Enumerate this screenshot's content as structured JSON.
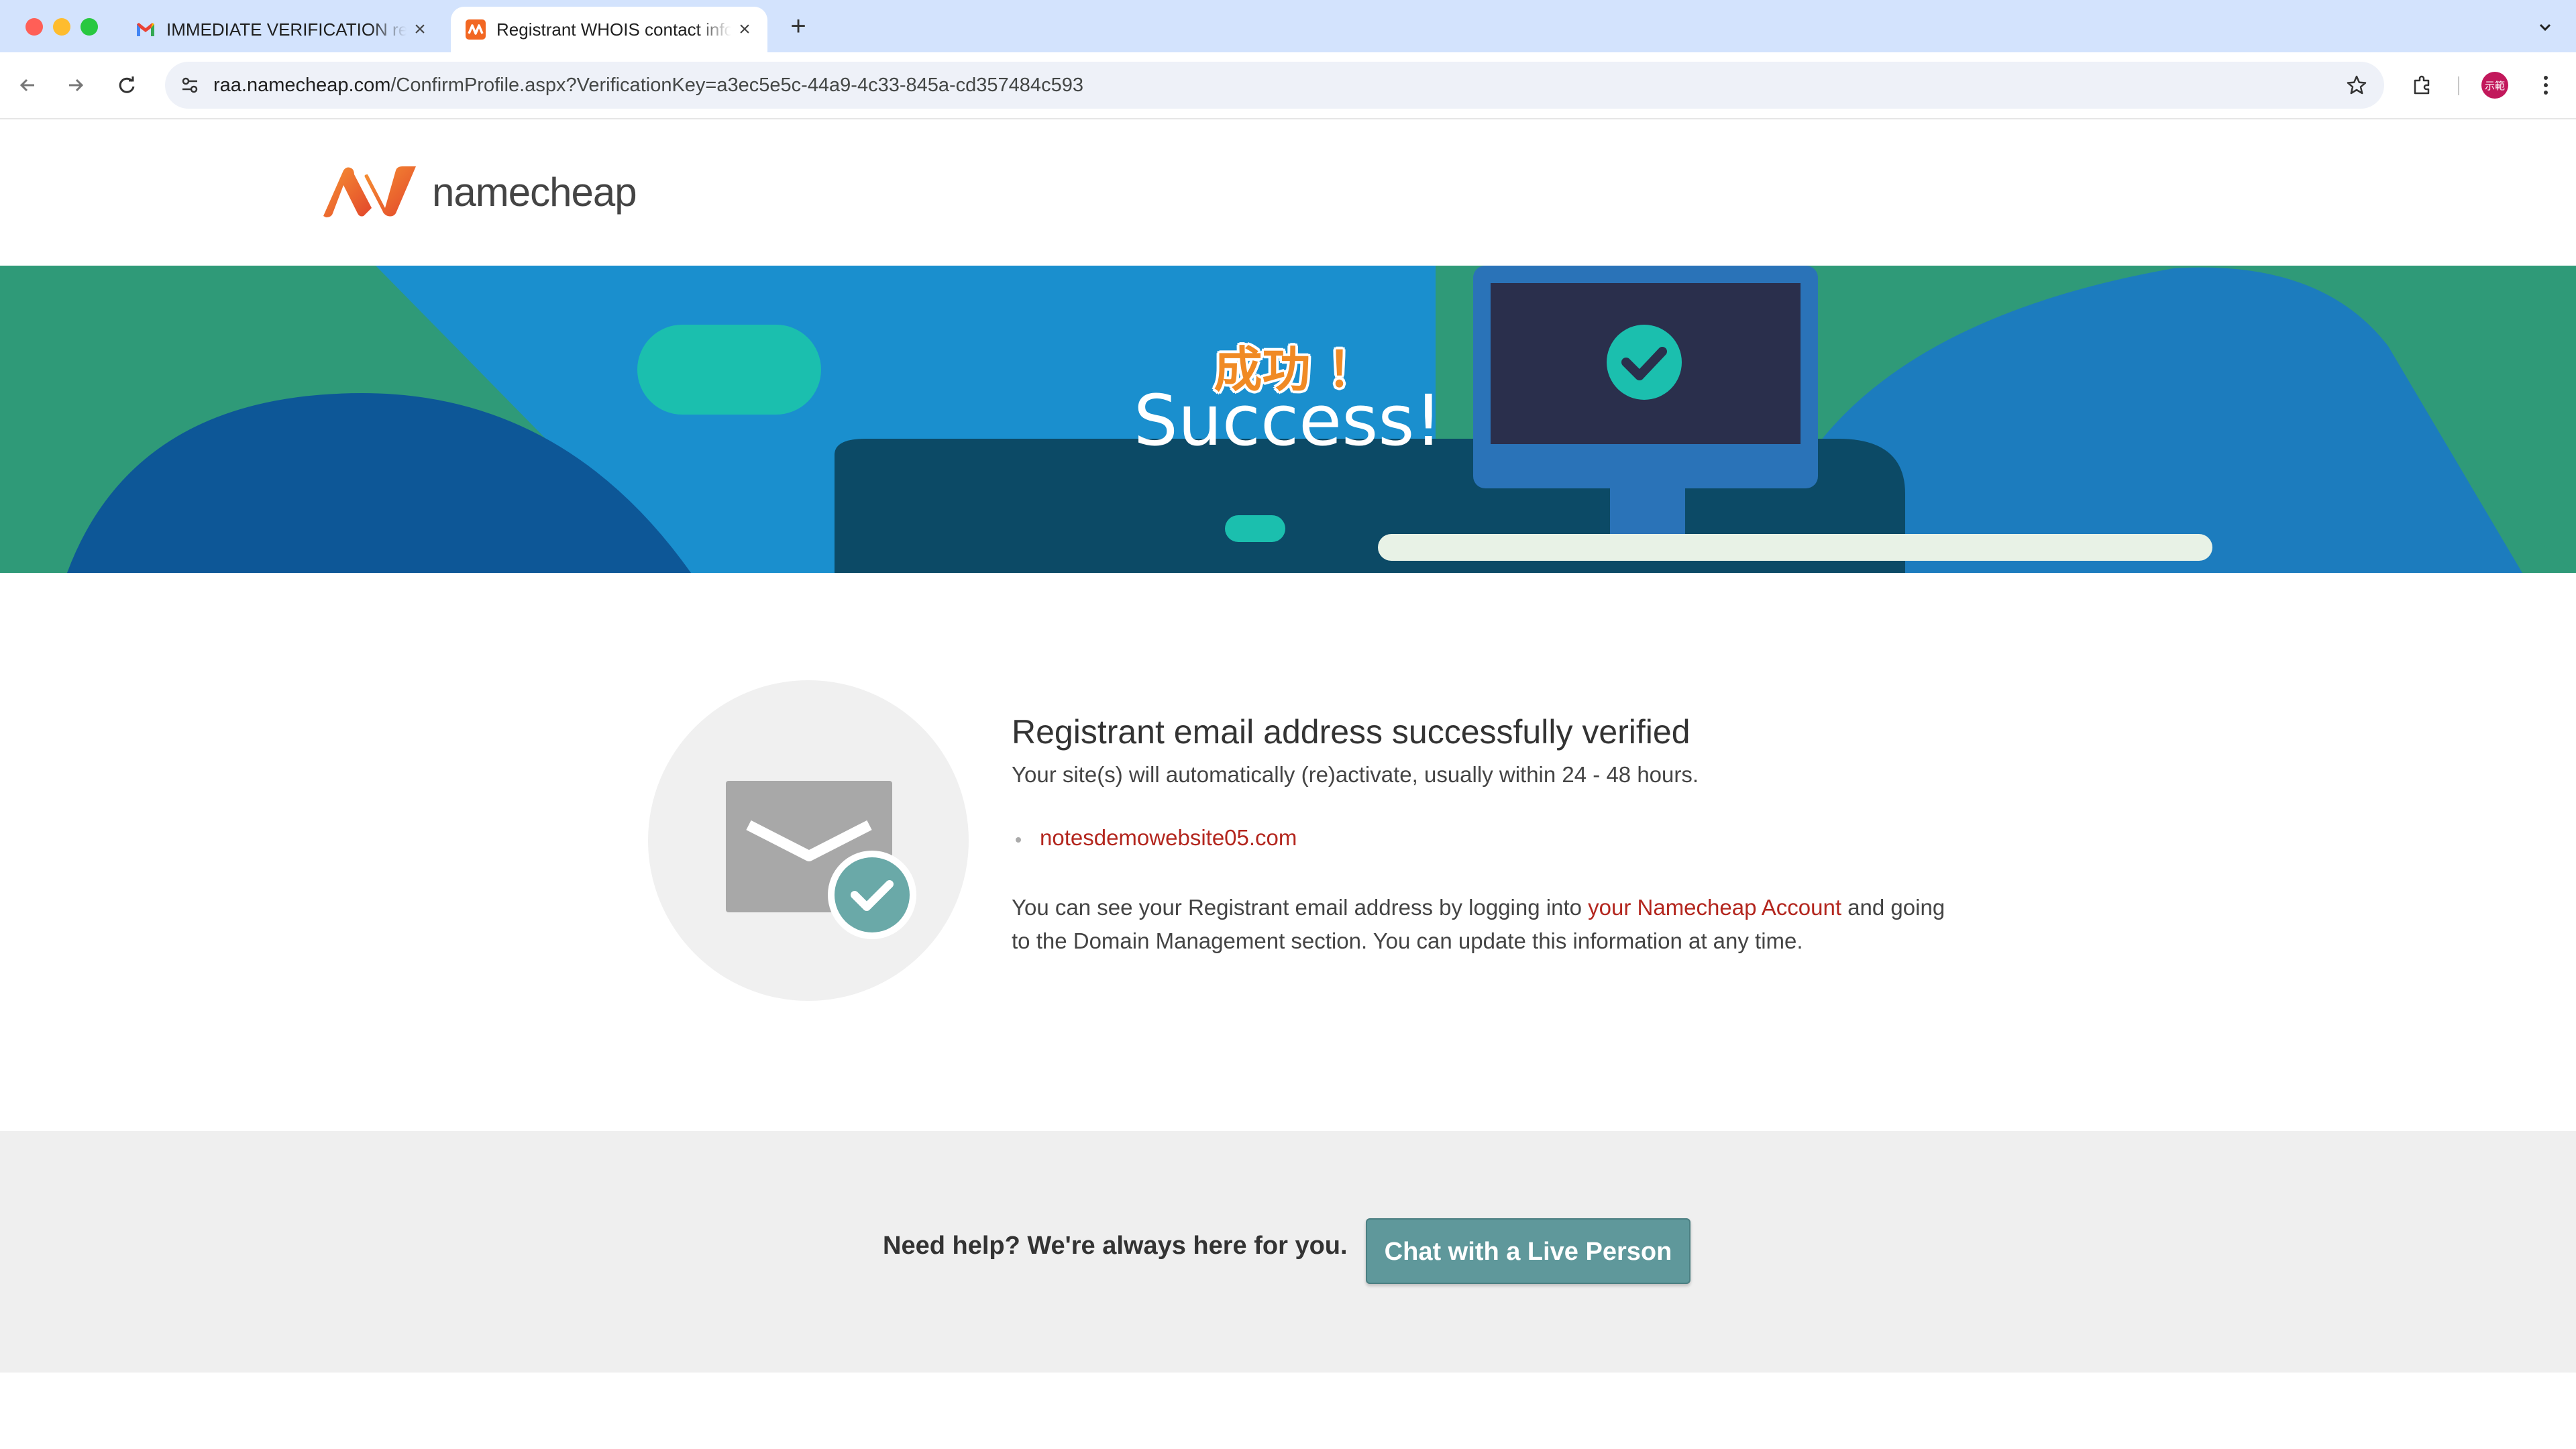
{
  "browser": {
    "tabs": [
      {
        "title": "IMMEDIATE VERIFICATION required",
        "icon": "gmail-icon",
        "active": false
      },
      {
        "title": "Registrant WHOIS contact information",
        "icon": "namecheap-favicon",
        "active": true
      }
    ],
    "url_host": "raa.namecheap.com",
    "url_path": "/ConfirmProfile.aspx?VerificationKey=a3ec5e5c-44a9-4c33-845a-cd357484c593",
    "avatar_text": "示範"
  },
  "header": {
    "logo_text": "namecheap"
  },
  "hero": {
    "chinese_title": "成功 ！",
    "title": "Success!"
  },
  "verification": {
    "heading": "Registrant email address successfully verified",
    "subtext": "Your site(s) will automatically (re)activate, usually within 24 - 48 hours.",
    "domains": [
      "notesdemowebsite05.com"
    ],
    "info_before": "You can see your Registrant email address by logging into ",
    "info_link": "your Namecheap Account",
    "info_after": " and going to the Domain Management section. You can update this information at any time."
  },
  "help": {
    "text": "Need help? We're always here for you.",
    "button_label": "Chat with a Live Person"
  },
  "colors": {
    "brand_orange": "#f26722",
    "link_red": "#b3261e",
    "button_teal": "#5f989b"
  }
}
